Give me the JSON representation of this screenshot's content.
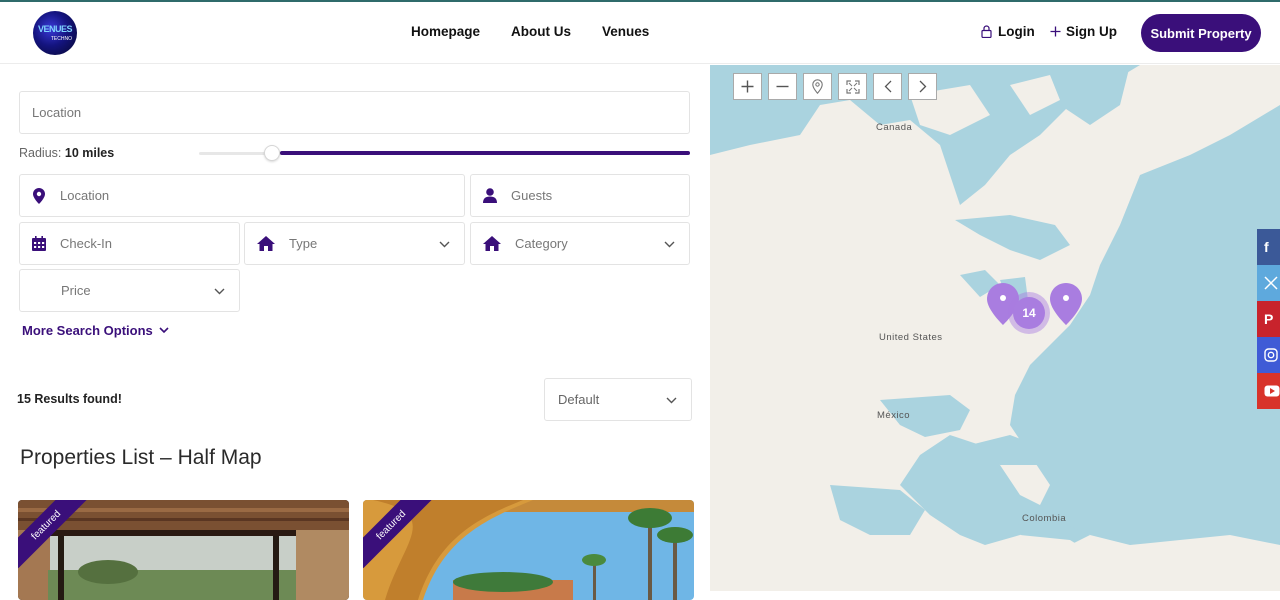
{
  "brand": {
    "logo_text": "VENUES",
    "logo_sub": "TECHNO"
  },
  "nav": {
    "items": [
      "Homepage",
      "About Us",
      "Venues"
    ]
  },
  "account": {
    "login": "Login",
    "signup": "Sign Up",
    "submit": "Submit Property"
  },
  "search": {
    "location_placeholder": "Location",
    "radius_label": "Radius:",
    "radius_value": "10 miles",
    "radius_level": 0.15,
    "location2_placeholder": "Location",
    "guests_placeholder": "Guests",
    "checkin_placeholder": "Check-In",
    "type_label": "Type",
    "category_label": "Category",
    "price_label": "Price",
    "more_options": "More Search Options"
  },
  "results": {
    "count_text": "15 Results found!",
    "sort_value": "Default"
  },
  "page": {
    "title": "Properties List – Half Map"
  },
  "listings": [
    {
      "badge": "featured"
    },
    {
      "badge": "featured"
    }
  ],
  "map": {
    "labels": [
      "Canada",
      "United States",
      "México",
      "Colombia"
    ],
    "cluster_count": "14"
  },
  "colors": {
    "accent": "#3a0f7a",
    "map_water": "#aad3df",
    "map_land": "#f2efe9",
    "marker": "#a97de0"
  },
  "social": [
    "facebook",
    "x",
    "pinterest",
    "instagram",
    "youtube"
  ]
}
